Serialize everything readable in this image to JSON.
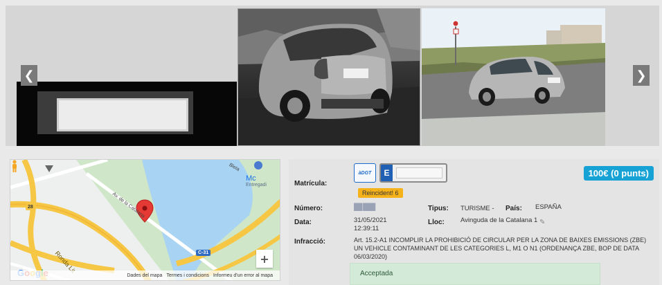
{
  "carousel": {
    "prev_icon": "chevron-left-icon",
    "next_icon": "chevron-right-icon",
    "prev_glyph": "❮",
    "next_glyph": "❯"
  },
  "map": {
    "city_label": "Mc",
    "city_label_sub": "Entregadi",
    "street_main": "Av. de la Catalana",
    "street_ronda": "Ronda Lit",
    "street_top": "Bleta",
    "route_28": "28",
    "route_c31": "C-31",
    "google_logo": "Google",
    "footer_links": [
      "Dades del mapa",
      "Termes i condicions",
      "Informeu d'un error al mapa"
    ],
    "zoom_in": "+",
    "colors": {
      "water": "#a9d3f2",
      "park": "#cfe7c8",
      "highway": "#f6c744"
    }
  },
  "details": {
    "matricula_label": "Matrícula:",
    "dgt_badge": "àDGT",
    "plate_country": "E",
    "reincident": "Reincident! 6",
    "fine": "100€ (0 punts)",
    "numero_label": "Número:",
    "numero_value": "██ ███",
    "tipus_label": "Tipus:",
    "tipus_value": "TURISME -",
    "pais_label": "País:",
    "pais_value": "ESPAÑA",
    "data_label": "Data:",
    "data_value_date": "31/05/2021",
    "data_value_time": "12:39:11",
    "lloc_label": "Lloc:",
    "lloc_value": "Avinguda de la Catalana 1",
    "infraccio_label": "Infracció:",
    "infraccio_value": "Art. 15.2-A1 INCOMPLIR LA PROHIBICIÓ DE CIRCULAR PER LA ZONA DE BAIXES EMISSIONS (ZBE) UN VEHICLE CONTAMINANT DE LES CATEGORIES L, M1 O N1 (ORDENANÇA ZBE, BOP DE DATA 06/03/2020)",
    "status": "Acceptada",
    "colors": {
      "fine": "#17a2d6",
      "reincident": "#f5b21b",
      "status_bg": "#d3ead9"
    }
  }
}
